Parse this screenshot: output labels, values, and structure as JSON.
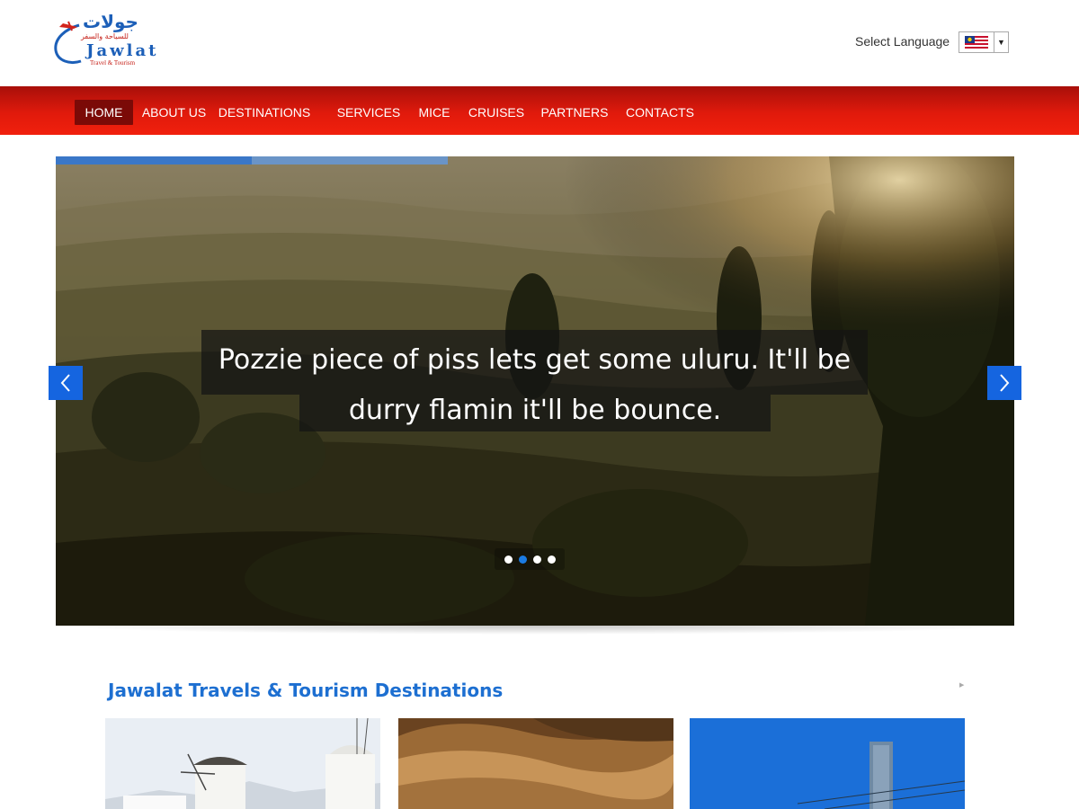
{
  "header": {
    "logo": {
      "arabic_name": "جولات",
      "arabic_tagline": "للسياحة والسفر",
      "latin_name": "Jawlat",
      "tagline": "Travel & Tourism"
    },
    "language": {
      "label": "Select Language",
      "selected_icon": "us-flag-icon"
    }
  },
  "nav": {
    "items": [
      {
        "label": "HOME",
        "active": true
      },
      {
        "label": "ABOUT US"
      },
      {
        "label": "DESTINATIONS"
      },
      {
        "label": "SERVICES"
      },
      {
        "label": "MICE"
      },
      {
        "label": "CRUISES"
      },
      {
        "label": "PARTNERS"
      },
      {
        "label": "CONTACTS"
      }
    ]
  },
  "slider": {
    "caption_line1": "Pozzie piece of piss lets get some uluru. It'll be",
    "caption_line2": "durry flamin it'll be bounce.",
    "slide_count": 4,
    "current_slide": 2,
    "prev_icon": "chevron-left-icon",
    "next_icon": "chevron-right-icon"
  },
  "destinations": {
    "title": "Jawalat Travels & Tourism Destinations",
    "cards": [
      {
        "image": "windmill-village-photo"
      },
      {
        "image": "golden-hills-photo"
      },
      {
        "image": "blue-sky-post-photo"
      }
    ]
  },
  "colors": {
    "nav_red": "#e01a0c",
    "nav_active": "#7b0a07",
    "accent_blue": "#1565e0",
    "title_blue": "#1d6fd1"
  }
}
